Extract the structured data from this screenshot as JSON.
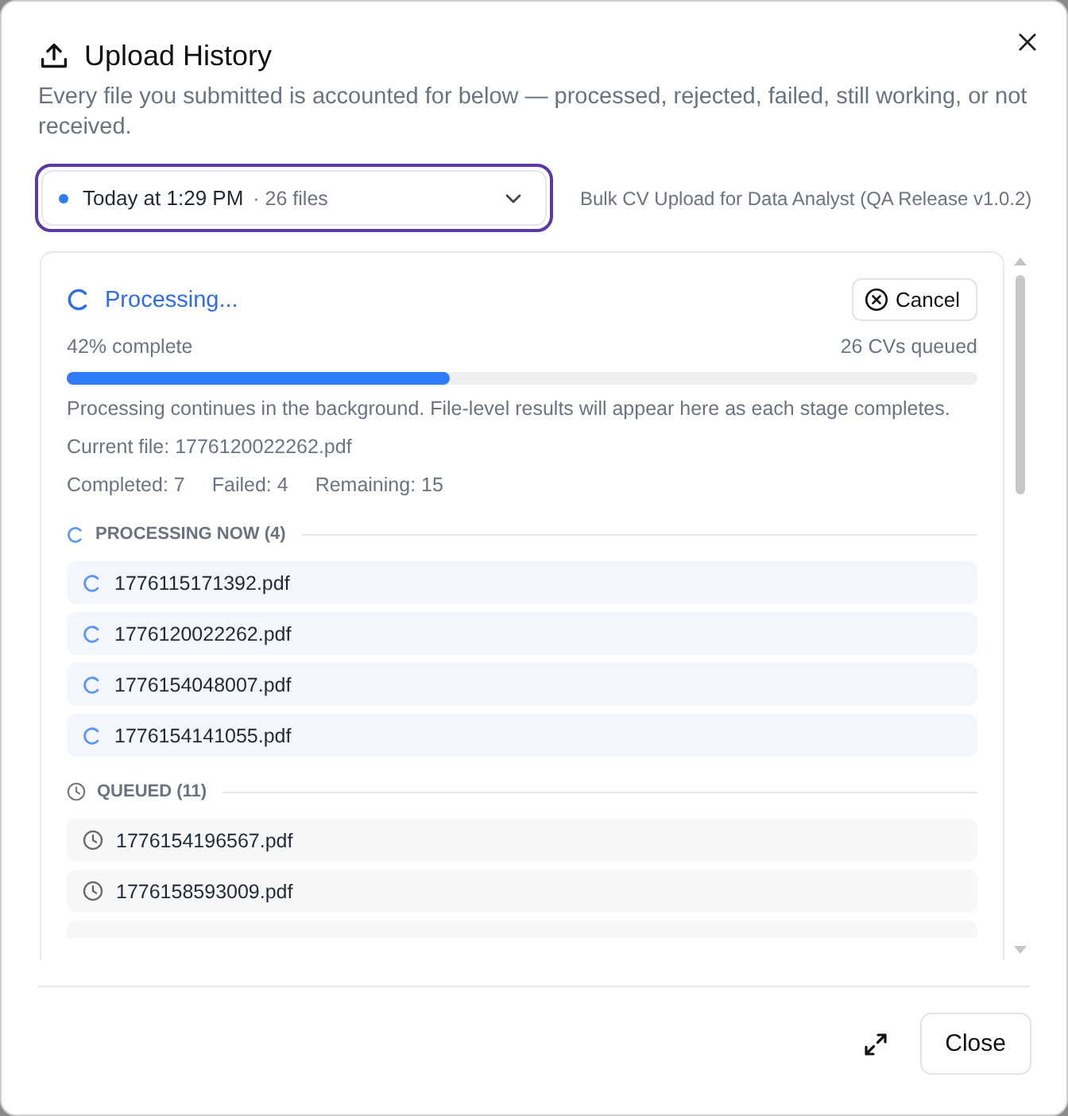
{
  "dialog": {
    "title": "Upload History",
    "subtitle": "Every file you submitted is accounted for below — processed, rejected, failed, still working, or not received."
  },
  "session_select": {
    "value": "Today at 1:29 PM",
    "count": "· 26 files",
    "focused": true
  },
  "batch_name": "Bulk CV Upload for Data Analyst (QA Release v1.0.2)",
  "progress": {
    "status": "Processing...",
    "cancel": "Cancel",
    "percent_label": "42% complete",
    "queued_label": "26 CVs queued",
    "level": 0.42,
    "note": "Processing continues in the background. File-level results will appear here as each stage completes.",
    "current_file": "Current file: 1776120022262.pdf",
    "stats": [
      "Completed: 7",
      "Failed: 4",
      "Remaining: 15"
    ]
  },
  "sections": [
    {
      "kind": "processing",
      "label": "PROCESSING NOW (4)",
      "files": [
        "1776115171392.pdf",
        "1776120022262.pdf",
        "1776154048007.pdf",
        "1776154141055.pdf"
      ]
    },
    {
      "kind": "queued",
      "label": "QUEUED (11)",
      "files": [
        "1776154196567.pdf",
        "1776158593009.pdf"
      ],
      "more_below": true
    }
  ],
  "footer": {
    "close": "Close"
  }
}
